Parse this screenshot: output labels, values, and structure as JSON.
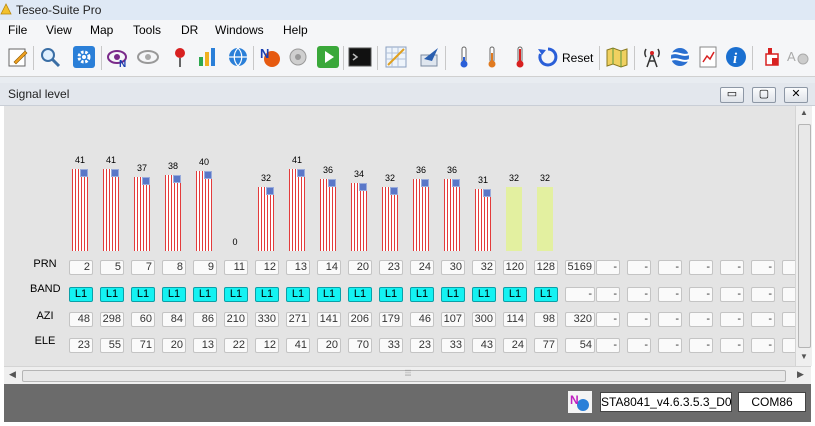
{
  "window": {
    "title": "Teseo-Suite Pro"
  },
  "menu": [
    "File",
    "View",
    "Map",
    "Tools",
    "DR",
    "Windows",
    "Help"
  ],
  "toolbar": {
    "reset_label": "Reset",
    "icons": [
      "edit-icon",
      "search-icon",
      "settings-icon",
      "satellite-view-icon",
      "eye-icon",
      "map-pin-icon",
      "bar-chart-icon",
      "globe-icon",
      "nmea-icon",
      "record-icon",
      "play-icon",
      "terminal-icon",
      "grid-icon",
      "send-icon",
      "thermometer-blue-icon",
      "thermometer-orange-icon",
      "thermometer-red-icon",
      "reset-icon",
      "map-icon",
      "antenna-icon",
      "earth-icon",
      "document-chart-icon",
      "info-icon",
      "usb-icon",
      "settings-grey-icon"
    ]
  },
  "panel": {
    "title": "Signal level",
    "minimize": "▭",
    "restore": "▢",
    "close": "✕"
  },
  "rows": {
    "prn_label": "PRN",
    "band_label": "BAND",
    "azi_label": "AZI",
    "ele_label": "ELE"
  },
  "channels": [
    {
      "level": "41",
      "snr": 41,
      "flag": true,
      "prn": "2",
      "band": "L1",
      "azi": "48",
      "ele": "23"
    },
    {
      "level": "41",
      "snr": 41,
      "flag": true,
      "prn": "5",
      "band": "L1",
      "azi": "298",
      "ele": "55"
    },
    {
      "level": "37",
      "snr": 37,
      "flag": true,
      "prn": "7",
      "band": "L1",
      "azi": "60",
      "ele": "71"
    },
    {
      "level": "38",
      "snr": 38,
      "flag": true,
      "prn": "8",
      "band": "L1",
      "azi": "84",
      "ele": "20"
    },
    {
      "level": "40",
      "snr": 40,
      "flag": true,
      "prn": "9",
      "band": "L1",
      "azi": "86",
      "ele": "13"
    },
    {
      "level": "0",
      "snr": 0,
      "flag": false,
      "prn": "11",
      "band": "L1",
      "azi": "210",
      "ele": "22"
    },
    {
      "level": "32",
      "snr": 32,
      "flag": true,
      "prn": "12",
      "band": "L1",
      "azi": "330",
      "ele": "12"
    },
    {
      "level": "41",
      "snr": 41,
      "flag": true,
      "prn": "13",
      "band": "L1",
      "azi": "271",
      "ele": "41"
    },
    {
      "level": "36",
      "snr": 36,
      "flag": true,
      "prn": "14",
      "band": "L1",
      "azi": "141",
      "ele": "20"
    },
    {
      "level": "34",
      "snr": 34,
      "flag": true,
      "prn": "20",
      "band": "L1",
      "azi": "206",
      "ele": "70"
    },
    {
      "level": "32",
      "snr": 32,
      "flag": true,
      "prn": "23",
      "band": "L1",
      "azi": "179",
      "ele": "33"
    },
    {
      "level": "36",
      "snr": 36,
      "flag": true,
      "prn": "24",
      "band": "L1",
      "azi": "46",
      "ele": "23"
    },
    {
      "level": "36",
      "snr": 36,
      "flag": true,
      "prn": "30",
      "band": "L1",
      "azi": "107",
      "ele": "33"
    },
    {
      "level": "31",
      "snr": 31,
      "flag": true,
      "prn": "32",
      "band": "L1",
      "azi": "300",
      "ele": "43"
    },
    {
      "level": "32",
      "snr": 32,
      "flag": false,
      "prn": "120",
      "band": "L1",
      "azi": "114",
      "ele": "24"
    },
    {
      "level": "32",
      "snr": 32,
      "flag": false,
      "prn": "128",
      "band": "L1",
      "azi": "98",
      "ele": "77"
    },
    {
      "level": "",
      "snr": 0,
      "flag": false,
      "prn": "5169",
      "band": "-",
      "azi": "320",
      "ele": "54"
    },
    {
      "level": "",
      "snr": 0,
      "flag": false,
      "prn": "-",
      "band": "-",
      "azi": "-",
      "ele": "-"
    },
    {
      "level": "",
      "snr": 0,
      "flag": false,
      "prn": "-",
      "band": "-",
      "azi": "-",
      "ele": "-"
    },
    {
      "level": "",
      "snr": 0,
      "flag": false,
      "prn": "-",
      "band": "-",
      "azi": "-",
      "ele": "-"
    },
    {
      "level": "",
      "snr": 0,
      "flag": false,
      "prn": "-",
      "band": "-",
      "azi": "-",
      "ele": "-"
    },
    {
      "level": "",
      "snr": 0,
      "flag": false,
      "prn": "-",
      "band": "-",
      "azi": "-",
      "ele": "-"
    },
    {
      "level": "",
      "snr": 0,
      "flag": false,
      "prn": "-",
      "band": "-",
      "azi": "-",
      "ele": "-"
    },
    {
      "level": "",
      "snr": 0,
      "flag": false,
      "prn": "-",
      "band": "-",
      "azi": "-",
      "ele": "-"
    }
  ],
  "status": {
    "firmware": "STA8041_v4.6.3.5.3_D0",
    "port": "COM86"
  },
  "colors": {
    "bar_stripe": "#e33b3b",
    "bar_plain": "#e3f0a0",
    "band_cell": "#14f2f2",
    "flag": "#5a77c8"
  }
}
